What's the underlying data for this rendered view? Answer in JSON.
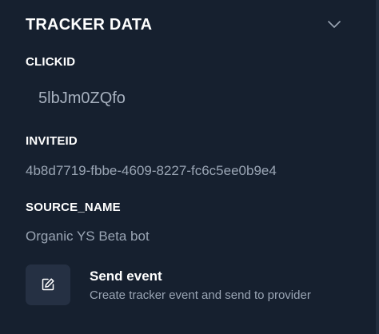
{
  "section": {
    "title": "TRACKER DATA",
    "collapse_icon": "chevron-down-icon"
  },
  "fields": [
    {
      "label": "CLICKID",
      "value": "5lbJm0ZQfo"
    },
    {
      "label": "INVITEID",
      "value": "4b8d7719-fbbe-4609-8227-fc6c5ee0b9e4"
    },
    {
      "label": "SOURCE_NAME",
      "value": "Organic YS Beta bot"
    }
  ],
  "action": {
    "icon": "edit-icon",
    "title": "Send event",
    "description": "Create tracker event and send to provider"
  },
  "colors": {
    "background": "#16202f",
    "muted_text": "#9aa5b4",
    "icon_tile": "#253043"
  }
}
